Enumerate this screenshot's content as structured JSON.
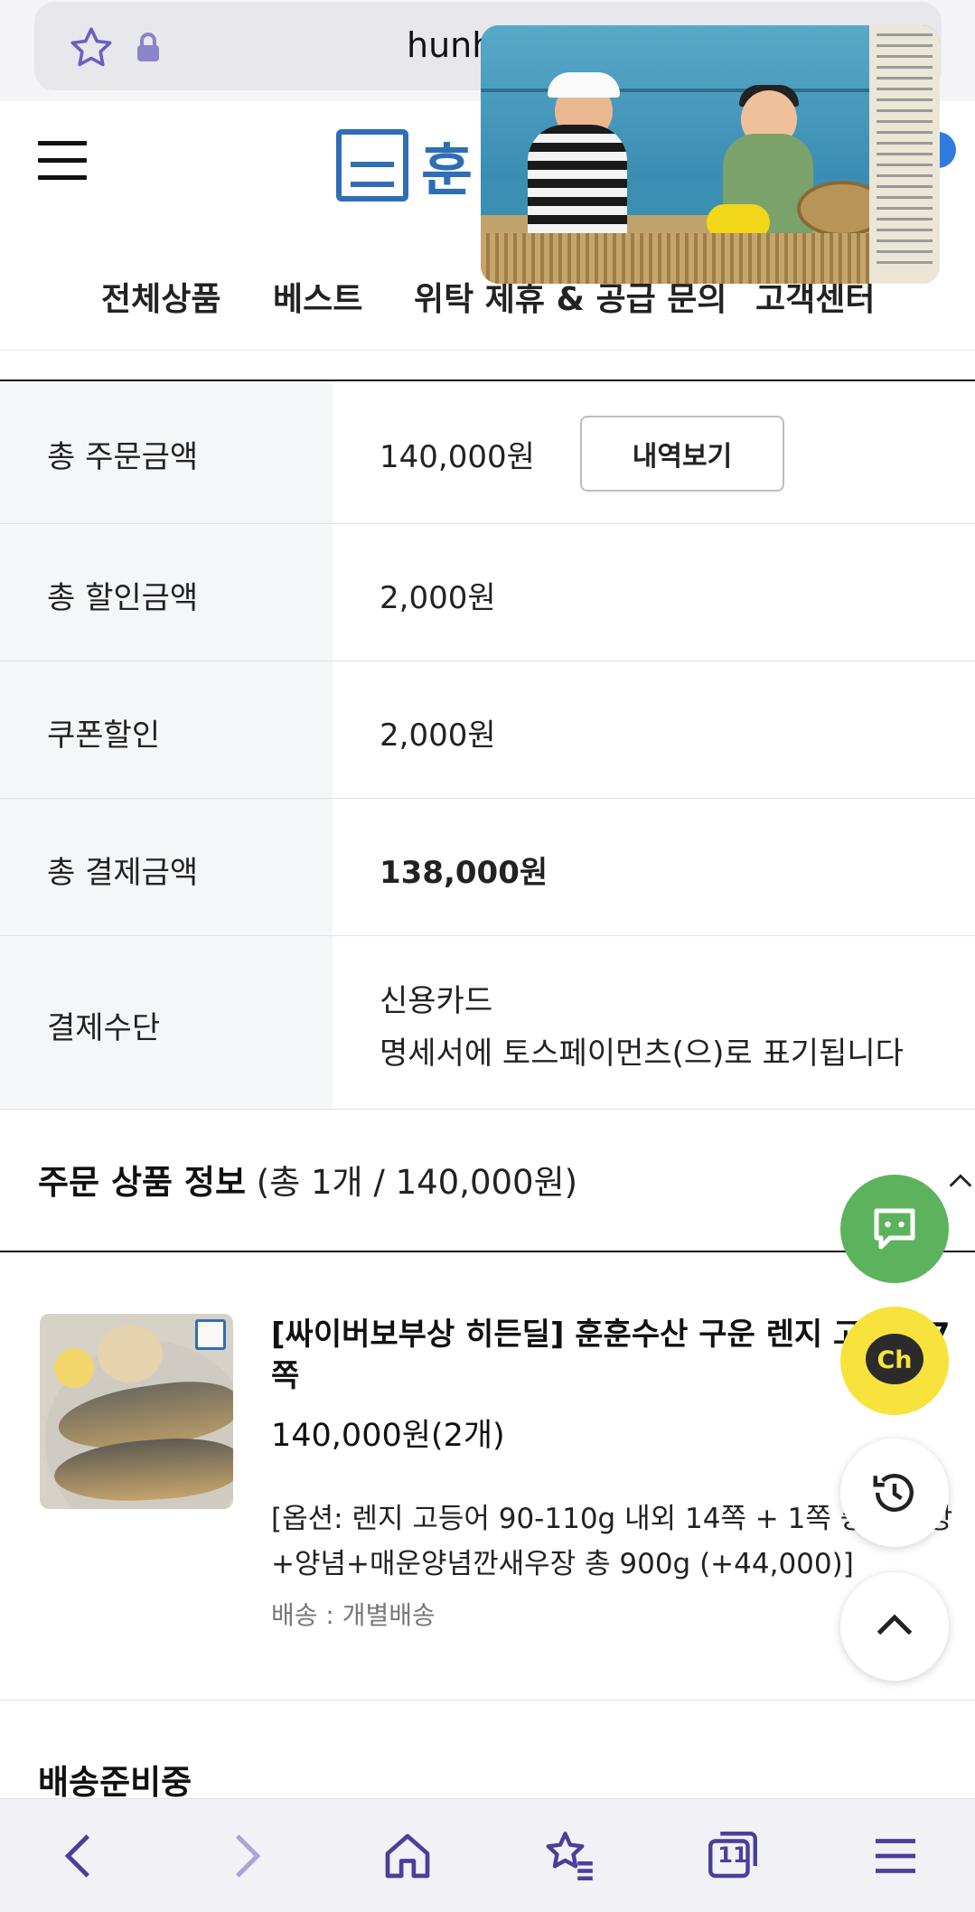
{
  "browser": {
    "url": "hunh",
    "tab_count": "11"
  },
  "header": {
    "logo_text": "훈",
    "nav": [
      "전체상품",
      "베스트",
      "위탁 제휴 & 공급 문의",
      "고객센터"
    ]
  },
  "order_summary": {
    "rows": [
      {
        "label": "총 주문금액",
        "value": "140,000원",
        "button": "내역보기"
      },
      {
        "label": "총 할인금액",
        "value": "2,000원"
      },
      {
        "label": "쿠폰할인",
        "value": "2,000원"
      },
      {
        "label": "총 결제금액",
        "value": "138,000원"
      },
      {
        "label": "결제수단",
        "value_line1": "신용카드",
        "value_line2": "명세서에 토스페이먼츠(으)로 표기됩니다"
      }
    ]
  },
  "order_items": {
    "title": "주문 상품 정보",
    "subtitle": "(총 1개 / 140,000원)",
    "items": [
      {
        "name": "[싸이버보부상 히든딜] 훈훈수산 구운 렌지 고등어 7쪽",
        "price": "140,000원(2개)",
        "option": "[옵션: 렌지 고등어 90-110g 내외 14쪽 + 1쪽 증정/간장+양념+매운양념깐새우장 총 900g (+44,000)]",
        "shipping": "배송 : 개별배송"
      }
    ]
  },
  "status": {
    "title": "배송준비중"
  },
  "floating": {
    "channel_label": "Ch"
  },
  "colors": {
    "brand": "#2f6eb5",
    "talk_green": "#5db35d",
    "channel_yellow": "#f8e33c",
    "browser_icon": "#4a3f9a"
  }
}
